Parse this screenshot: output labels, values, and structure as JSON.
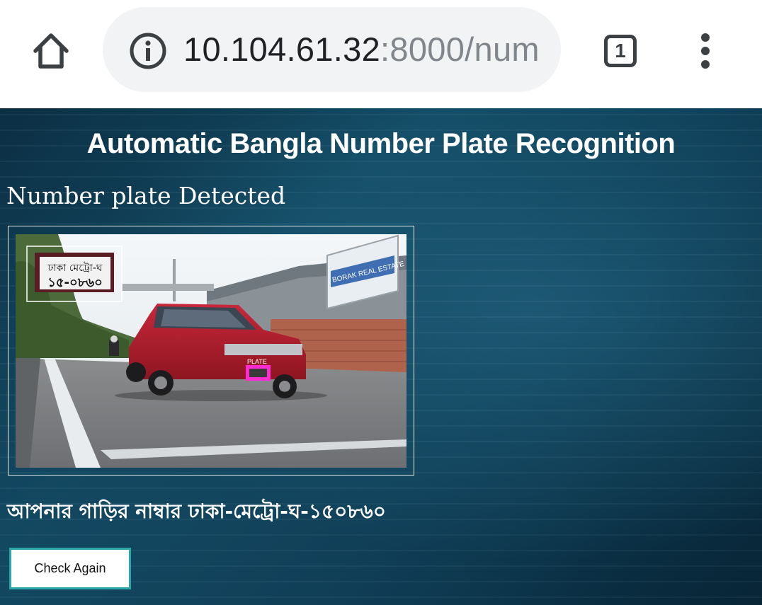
{
  "browser": {
    "url_host": "10.104.61.32",
    "url_rest": ":8000/num",
    "tab_count": "1",
    "icons": [
      "home-icon",
      "info-icon",
      "tab-switcher-icon",
      "overflow-menu-icon"
    ]
  },
  "page": {
    "title": "Automatic Bangla Number Plate Recognition",
    "section_heading": "Number plate Detected",
    "result_text": "আপনার গাড়ির নাম্বার ঢাকা-মেট্রো-ঘ-১৫০৮৬০",
    "check_again_label": "Check Again"
  },
  "image": {
    "billboard_text": "BORAK REAL ESTATE",
    "detection_label": "PLATE",
    "plate_line1": "ঢাকা মেট্রো-ঘ",
    "plate_line2": "১৫-০৮৬০"
  },
  "colors": {
    "page_bg": "#0d3a52",
    "button_border": "#2aa7a7",
    "detection_box": "#ff00ff"
  }
}
